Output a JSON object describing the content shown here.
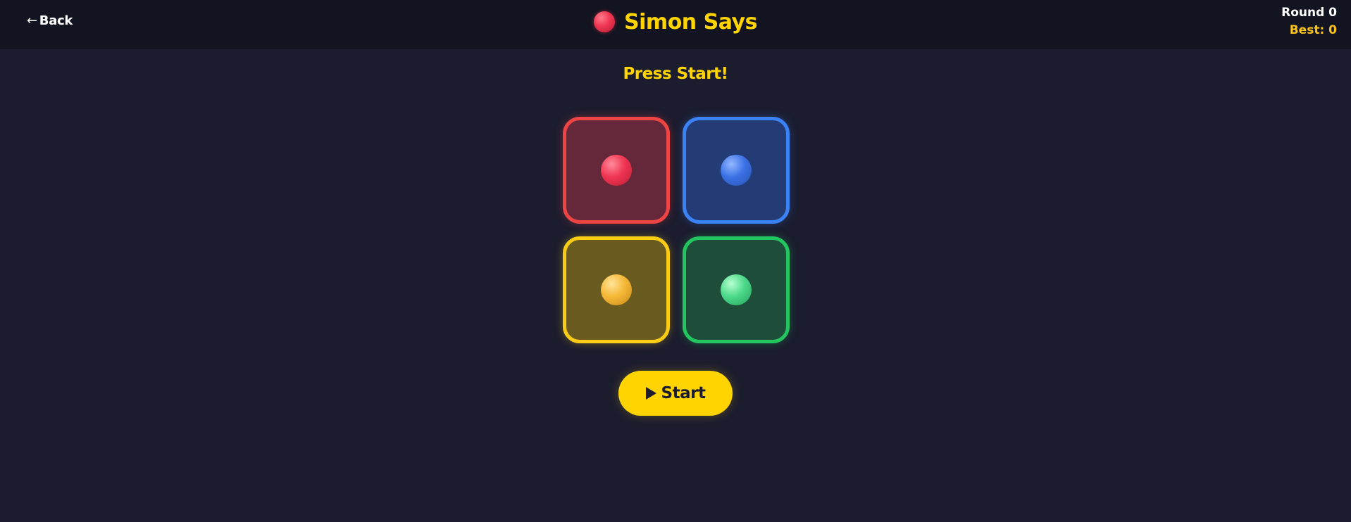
{
  "header": {
    "back_label": "Back",
    "back_icon": "left-arrow-icon",
    "title": "Simon Says",
    "title_icon": "red-ball-icon",
    "round_text": "Round 0",
    "best_text": "Best: 0"
  },
  "game": {
    "status": "Press Start!",
    "pads": [
      {
        "color_name": "red",
        "border_color": "#ef4444"
      },
      {
        "color_name": "blue",
        "border_color": "#3b82f6"
      },
      {
        "color_name": "yellow",
        "border_color": "#facc15"
      },
      {
        "color_name": "green",
        "border_color": "#22c55e"
      }
    ],
    "start_label": "Start",
    "start_icon": "play-icon"
  },
  "colors": {
    "accent": "#ffd400",
    "background": "#1b1c2e",
    "header_background": "#131421",
    "best_color": "#fcc419"
  }
}
